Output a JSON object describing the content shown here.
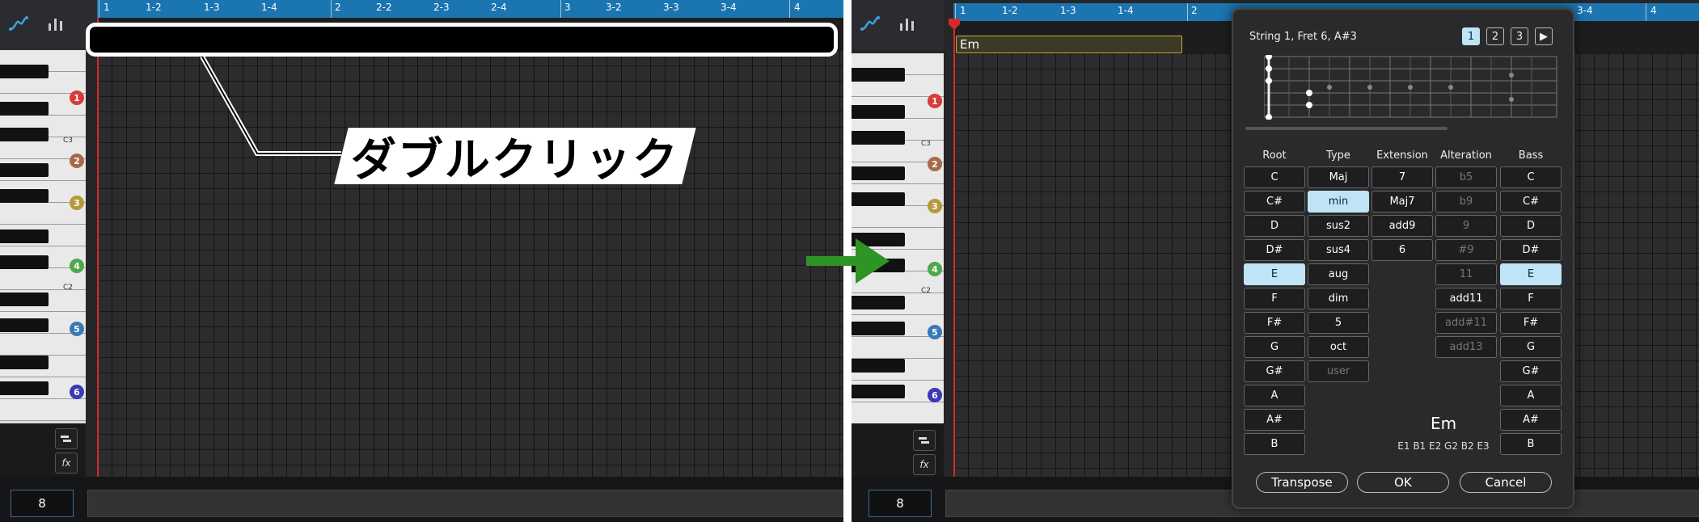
{
  "colors": {
    "ruler": "#1b75b1",
    "accent_selected": "#bfe4f6",
    "arrow": "#2f9426",
    "playhead": "#d22b2b",
    "region_border": "#d4a73b"
  },
  "toolbar": {
    "icons": [
      "curve-icon",
      "velocity-bars-icon"
    ]
  },
  "ruler_left": [
    "1",
    "1-2",
    "1-3",
    "1-4",
    "2",
    "2-2",
    "2-3",
    "2-4",
    "3",
    "3-2",
    "3-3",
    "3-4",
    "4"
  ],
  "ruler_right": [
    "1",
    "1-2",
    "1-3",
    "1-4",
    "2",
    "3-4",
    "4"
  ],
  "piano": {
    "octave_badges": [
      "1",
      "2",
      "3",
      "4",
      "5",
      "6"
    ],
    "c_labels": [
      "C3",
      "C2"
    ]
  },
  "side_tools": {
    "fx_label": "fx"
  },
  "bottom": {
    "value": "8"
  },
  "callout": {
    "text": "ダブルクリック"
  },
  "region": {
    "label": "Em"
  },
  "dialog": {
    "title": "String 1, Fret 6, A#3",
    "pages": [
      "1",
      "2",
      "3"
    ],
    "play_label": "▶",
    "columns": {
      "root": {
        "header": "Root",
        "items": [
          "C",
          "C#",
          "D",
          "D#",
          "E",
          "F",
          "F#",
          "G",
          "G#",
          "A",
          "A#",
          "B"
        ]
      },
      "type": {
        "header": "Type",
        "items": [
          "Maj",
          "min",
          "sus2",
          "sus4",
          "aug",
          "dim",
          "5",
          "oct",
          "user"
        ]
      },
      "extension": {
        "header": "Extension",
        "items": [
          "7",
          "Maj7",
          "add9",
          "6"
        ]
      },
      "alteration": {
        "header": "Alteration",
        "items": [
          "b5",
          "b9",
          "9",
          "#9",
          "11",
          "add11",
          "add#11",
          "add13"
        ]
      },
      "bass": {
        "header": "Bass",
        "items": [
          "C",
          "C#",
          "D",
          "D#",
          "E",
          "F",
          "F#",
          "G",
          "G#",
          "A",
          "A#",
          "B"
        ]
      }
    },
    "chord_name": "Em",
    "chord_notes": "E1 B1 E2 G2 B2 E3",
    "buttons": {
      "transpose": "Transpose",
      "ok": "OK",
      "cancel": "Cancel"
    }
  }
}
